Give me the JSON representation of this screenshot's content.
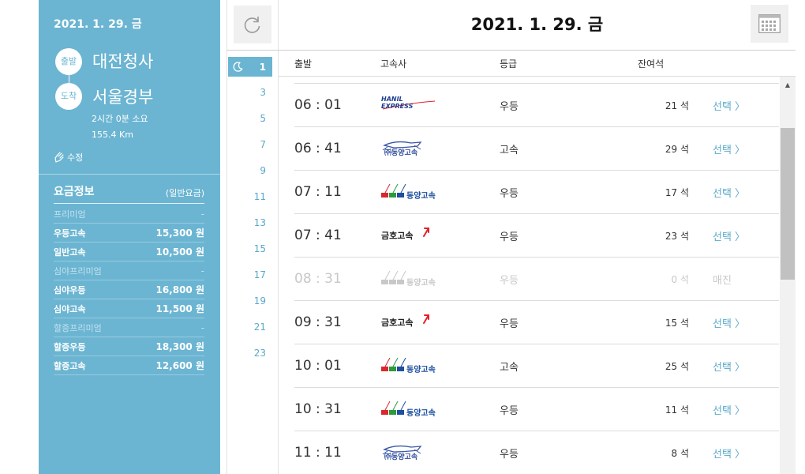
{
  "side": {
    "date": "2021. 1. 29. 금",
    "depart_badge": "출발",
    "arrive_badge": "도착",
    "depart_place": "대전청사",
    "arrive_place": "서울경부",
    "duration": "2시간 0분 소요",
    "distance": "155.4 Km",
    "edit_label": "수정",
    "fare_title": "요금정보",
    "fare_subtitle": "(일반요금)",
    "fares": [
      {
        "label": "프리미엄",
        "price": "-",
        "category": true
      },
      {
        "label": "우등고속",
        "price": "15,300 원",
        "category": false
      },
      {
        "label": "일반고속",
        "price": "10,500 원",
        "category": false
      },
      {
        "label": "심야프리미엄",
        "price": "-",
        "category": true
      },
      {
        "label": "심야우등",
        "price": "16,800 원",
        "category": false
      },
      {
        "label": "심야고속",
        "price": "11,500 원",
        "category": false
      },
      {
        "label": "할증프리미엄",
        "price": "-",
        "category": true
      },
      {
        "label": "할증우등",
        "price": "18,300 원",
        "category": false
      },
      {
        "label": "할증고속",
        "price": "12,600 원",
        "category": false
      }
    ]
  },
  "header": {
    "title": "2021. 1. 29. 금",
    "refresh_icon": "refresh-icon",
    "calendar_icon": "calendar-icon"
  },
  "hours": {
    "active": "1",
    "list": [
      "3",
      "5",
      "7",
      "9",
      "11",
      "13",
      "15",
      "17",
      "19",
      "21",
      "23"
    ]
  },
  "table": {
    "col_depart": "출발",
    "col_company": "고속사",
    "col_grade": "등급",
    "col_seats": "잔여석",
    "rows": [
      {
        "time": "06 : 01",
        "company": "hanil",
        "logo_text": "HANIL EXPRESS",
        "grade": "우등",
        "seats": "21 석",
        "action": "선택 〉",
        "sold": false
      },
      {
        "time": "06 : 41",
        "company": "dongyang-old",
        "logo_text": "㈜동양고속",
        "grade": "고속",
        "seats": "29 석",
        "action": "선택 〉",
        "sold": false
      },
      {
        "time": "07 : 11",
        "company": "dongyang",
        "logo_text": "동양고속",
        "grade": "우등",
        "seats": "17 석",
        "action": "선택 〉",
        "sold": false
      },
      {
        "time": "07 : 41",
        "company": "kumho",
        "logo_text": "금호고속",
        "grade": "우등",
        "seats": "23 석",
        "action": "선택 〉",
        "sold": false
      },
      {
        "time": "08 : 31",
        "company": "dongyang",
        "logo_text": "동양고속",
        "grade": "우등",
        "seats": "0 석",
        "action": "매진",
        "sold": true
      },
      {
        "time": "09 : 31",
        "company": "kumho",
        "logo_text": "금호고속",
        "grade": "우등",
        "seats": "15 석",
        "action": "선택 〉",
        "sold": false
      },
      {
        "time": "10 : 01",
        "company": "dongyang",
        "logo_text": "동양고속",
        "grade": "고속",
        "seats": "25 석",
        "action": "선택 〉",
        "sold": false
      },
      {
        "time": "10 : 31",
        "company": "dongyang",
        "logo_text": "동양고속",
        "grade": "우등",
        "seats": "11 석",
        "action": "선택 〉",
        "sold": false
      },
      {
        "time": "11 : 11",
        "company": "dongyang-old",
        "logo_text": "㈜동양고속",
        "grade": "우등",
        "seats": "8 석",
        "action": "선택 〉",
        "sold": false
      }
    ]
  },
  "colors": {
    "accent": "#6bb5d2",
    "link": "#5aa8c8",
    "kumho_red": "#e4202a",
    "dongyang_red": "#d7282f",
    "dongyang_green": "#2e9a3c",
    "dongyang_blue": "#1c4fa0"
  }
}
